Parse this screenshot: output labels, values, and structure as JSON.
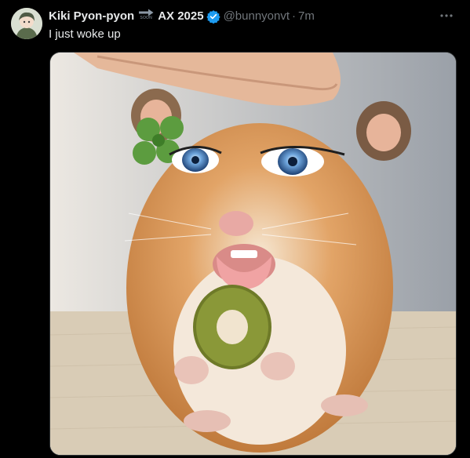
{
  "author": {
    "display_name": "Kiki Pyon-pyon",
    "badge_icon": "soon-arrow-icon",
    "badge_text": "SOON",
    "name_suffix": "AX 2025",
    "verified_icon": "verified-badge-icon",
    "verified_color": "#1d9bf0",
    "handle": "@bunnyonvt",
    "separator": "·",
    "time": "7m"
  },
  "tweet": {
    "text": "I just woke up"
  },
  "actions": {
    "more_icon": "more-options-icon"
  },
  "colors": {
    "background": "#000000",
    "text": "#e7e9ea",
    "muted": "#71767b"
  }
}
